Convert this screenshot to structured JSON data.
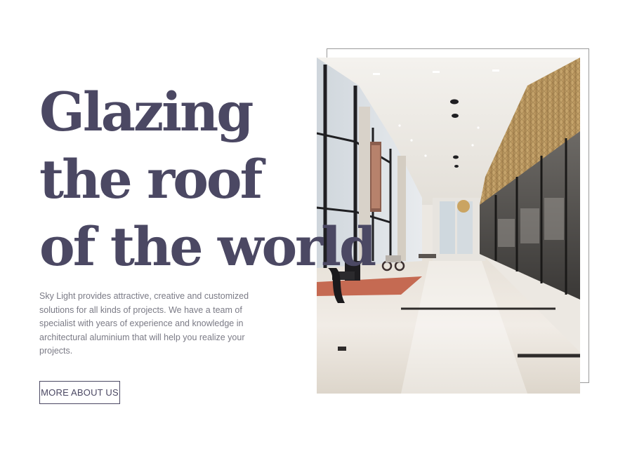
{
  "hero": {
    "headline_lines": [
      "Glazing",
      "the roof",
      "of the world"
    ],
    "description": "Sky Light provides attractive, creative and customized solutions for all kinds of projects. We have a team of specialist with years of experience and knowledge in architectural aluminium that will help you realize your projects.",
    "button_label": "MORE ABOUT US"
  },
  "image": {
    "subject": "interior-hallway-photo"
  },
  "colors": {
    "heading": "#4b4863",
    "body_text": "#7b7b86",
    "frame_border": "#9a9a9a",
    "background": "#ffffff"
  }
}
